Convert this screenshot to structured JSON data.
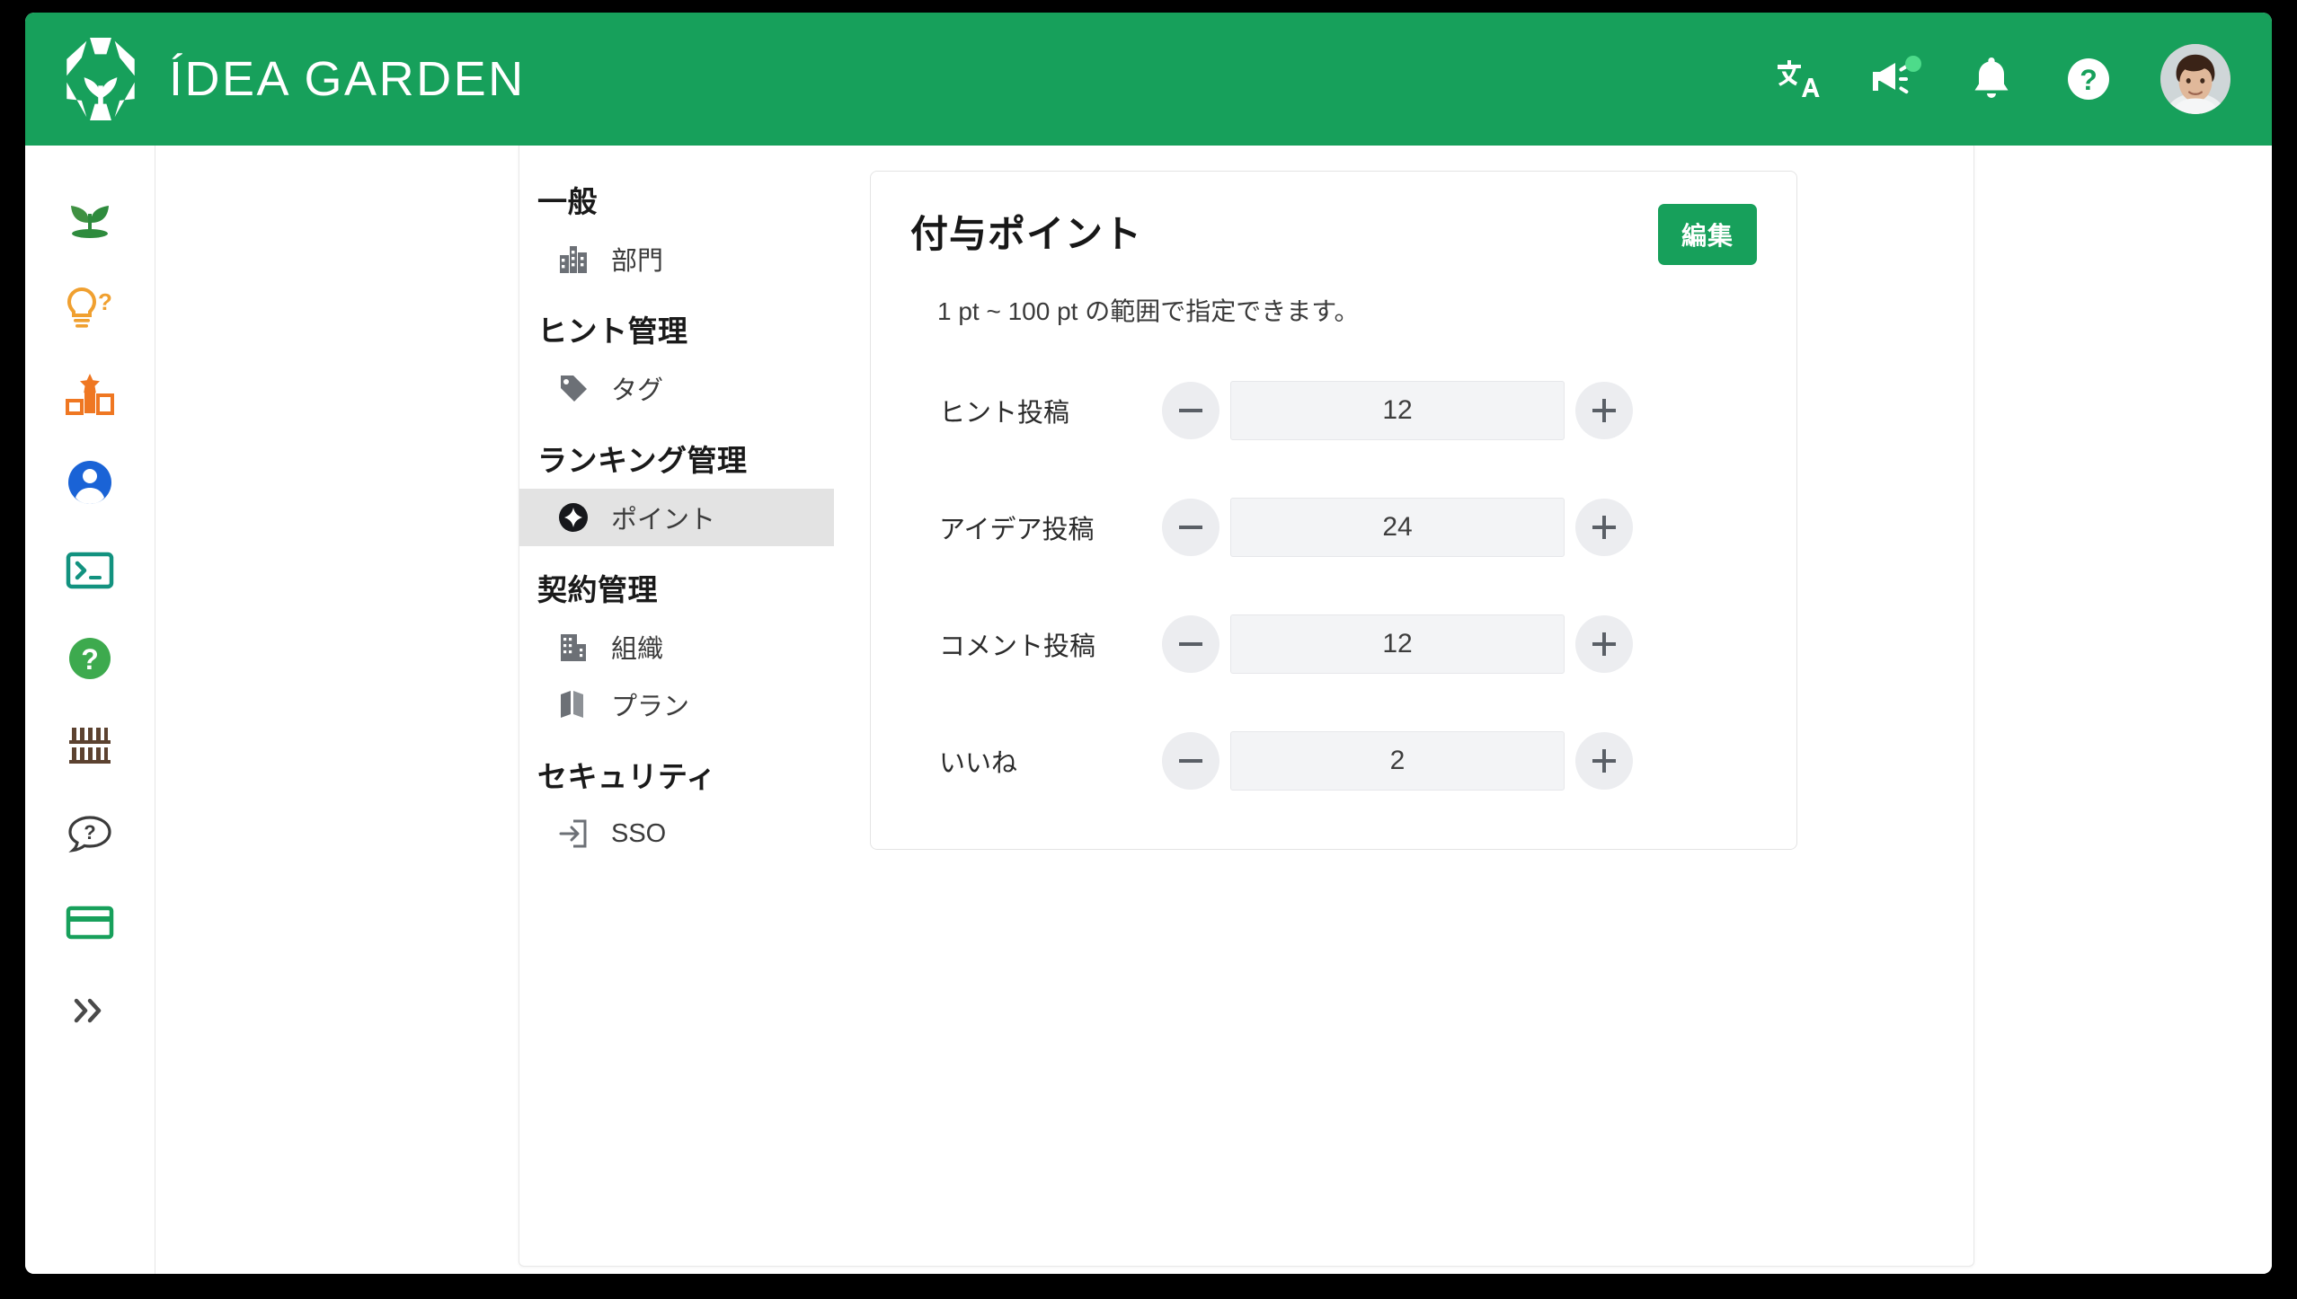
{
  "header": {
    "brand_title": "ÍDEA GARDEN",
    "logo_icon": "hexagon-sprout-logo",
    "accent_color": "#17a05b",
    "icons": [
      {
        "name": "translate-icon",
        "glyph": "文A"
      },
      {
        "name": "announcement-megaphone-icon",
        "glyph": "megaphone",
        "badge": true
      },
      {
        "name": "notifications-bell-icon",
        "glyph": "bell"
      },
      {
        "name": "help-circle-icon",
        "glyph": "?"
      }
    ],
    "avatar": {
      "name": "user-avatar",
      "alt": "account photo"
    }
  },
  "rail": {
    "items": [
      {
        "name": "rail-item-sprout",
        "icon": "sprout-icon",
        "color": "#2e8b3d"
      },
      {
        "name": "rail-item-hints",
        "icon": "lightbulb-question-icon",
        "color": "#f0a030"
      },
      {
        "name": "rail-item-ranking",
        "icon": "podium-star-icon",
        "color": "#ef7722"
      },
      {
        "name": "rail-item-account",
        "icon": "person-circle-icon",
        "color": "#1a63d6"
      },
      {
        "name": "rail-item-console",
        "icon": "terminal-icon",
        "color": "#12927f"
      },
      {
        "name": "rail-item-help",
        "icon": "help-circle-filled-icon",
        "color": "#3daa4e"
      },
      {
        "name": "rail-item-library",
        "icon": "bookshelf-icon",
        "color": "#5c4230"
      },
      {
        "name": "rail-item-faq",
        "icon": "speech-bubble-question-icon",
        "color": "#3b3b3b"
      },
      {
        "name": "rail-item-billing",
        "icon": "credit-card-icon",
        "color": "#17a05b"
      },
      {
        "name": "rail-expand-toggle",
        "icon": "double-chevron-right-icon",
        "color": "#4a4a4a"
      }
    ]
  },
  "settings_nav": {
    "groups": [
      {
        "title": "一般",
        "items": [
          {
            "label": "部門",
            "icon": "building-icon",
            "selected": false
          }
        ]
      },
      {
        "title": "ヒント管理",
        "items": [
          {
            "label": "タグ",
            "icon": "tag-icon",
            "selected": false
          }
        ]
      },
      {
        "title": "ランキング管理",
        "items": [
          {
            "label": "ポイント",
            "icon": "point-star-circle-icon",
            "selected": true
          }
        ]
      },
      {
        "title": "契約管理",
        "items": [
          {
            "label": "組織",
            "icon": "organization-building-icon",
            "selected": false
          },
          {
            "label": "プラン",
            "icon": "map-plan-icon",
            "selected": false
          }
        ]
      },
      {
        "title": "セキュリティ",
        "items": [
          {
            "label": "SSO",
            "icon": "login-arrow-icon",
            "selected": false
          }
        ]
      }
    ]
  },
  "card": {
    "title": "付与ポイント",
    "edit_label": "編集",
    "subtitle": "1 pt ~ 100 pt の範囲で指定できます。",
    "minus_label": "−",
    "plus_label": "+",
    "rows": [
      {
        "label": "ヒント投稿",
        "value": "12"
      },
      {
        "label": "アイデア投稿",
        "value": "24"
      },
      {
        "label": "コメント投稿",
        "value": "12"
      },
      {
        "label": "いいね",
        "value": "2"
      }
    ]
  }
}
